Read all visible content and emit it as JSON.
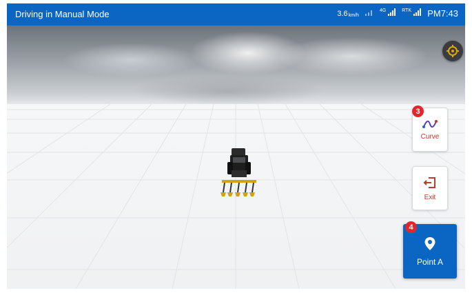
{
  "status_bar": {
    "title": "Driving in Manual Mode",
    "speed": "3.6",
    "speed_unit": "km/h",
    "network_label": "4G",
    "rtk_label": "RTK",
    "time": "PM7:43"
  },
  "controls": {
    "curve_label": "Curve",
    "exit_label": "Exit",
    "point_a_label": "Point A",
    "curve_badge": "3",
    "point_a_badge": "4"
  },
  "colors": {
    "accent": "#0b66c3",
    "badge": "#e4262b",
    "button_text": "#c0392b",
    "locate_icon": "#e0a800"
  },
  "icons": {
    "wifi": "wifi-icon",
    "signal": "signal-icon",
    "locate": "locate-icon",
    "curve": "curve-icon",
    "exit": "exit-icon",
    "point": "location-pin-icon"
  }
}
